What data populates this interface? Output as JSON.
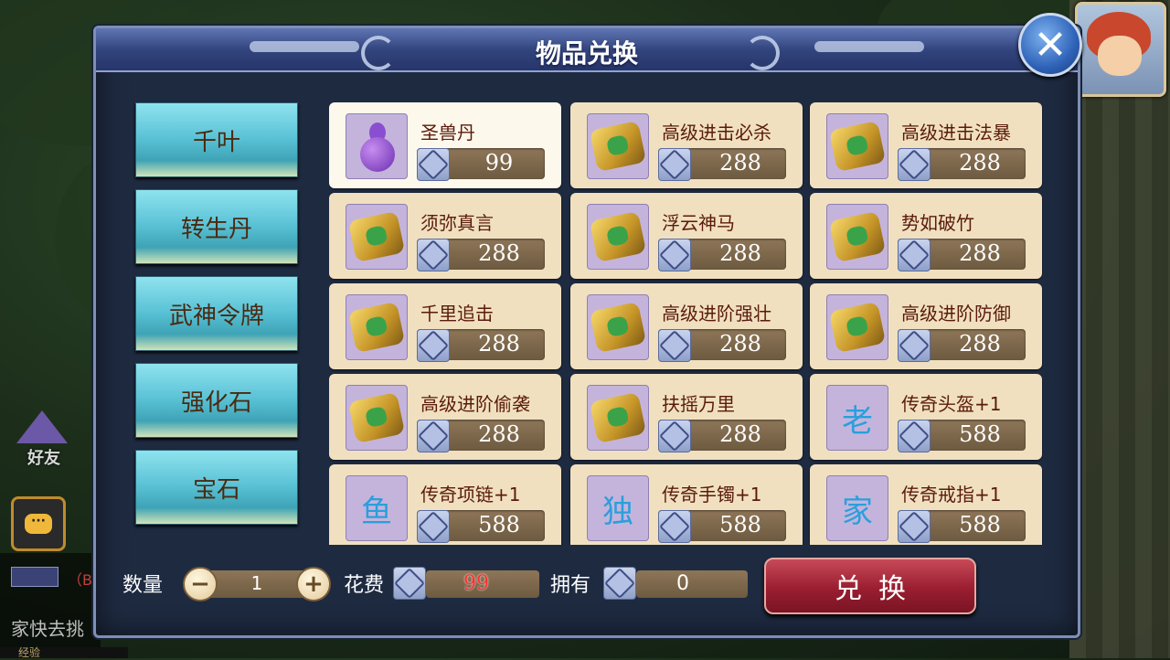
{
  "dialog": {
    "title": "物品兑换"
  },
  "categories": [
    "千叶",
    "转生丹",
    "武神令牌",
    "强化石",
    "宝石"
  ],
  "items": [
    {
      "name": "圣兽丹",
      "price": "99",
      "icon": "gourd-icon",
      "selected": true
    },
    {
      "name": "高级进击必杀",
      "price": "288",
      "icon": "scroll-icon"
    },
    {
      "name": "高级进击法暴",
      "price": "288",
      "icon": "scroll-icon"
    },
    {
      "name": "须弥真言",
      "price": "288",
      "icon": "scroll-icon"
    },
    {
      "name": "浮云神马",
      "price": "288",
      "icon": "scroll-icon"
    },
    {
      "name": "势如破竹",
      "price": "288",
      "icon": "scroll-icon"
    },
    {
      "name": "千里追击",
      "price": "288",
      "icon": "scroll-icon"
    },
    {
      "name": "高级进阶强壮",
      "price": "288",
      "icon": "scroll-icon"
    },
    {
      "name": "高级进阶防御",
      "price": "288",
      "icon": "scroll-icon"
    },
    {
      "name": "高级进阶偷袭",
      "price": "288",
      "icon": "scroll-icon"
    },
    {
      "name": "扶摇万里",
      "price": "288",
      "icon": "scroll-icon"
    },
    {
      "name": "传奇头盔+1",
      "price": "588",
      "icon": "glyph-icon",
      "glyph": "老"
    },
    {
      "name": "传奇项链+1",
      "price": "588",
      "icon": "glyph-icon",
      "glyph": "鱼"
    },
    {
      "name": "传奇手镯+1",
      "price": "588",
      "icon": "glyph-icon",
      "glyph": "独"
    },
    {
      "name": "传奇戒指+1",
      "price": "588",
      "icon": "glyph-icon",
      "glyph": "家"
    }
  ],
  "footer": {
    "qty_label": "数量",
    "qty_value": "1",
    "minus": "−",
    "plus": "+",
    "cost_label": "花费",
    "cost_value": "99",
    "own_label": "拥有",
    "own_value": "0",
    "exchange_label": "兑换"
  },
  "hud": {
    "friends_label": "好友",
    "chat_icon": "···",
    "chat_line": "家快去挑",
    "chat_b": "（B",
    "exp_label": "经验"
  },
  "colors": {
    "price_text": "#ffffff",
    "cost_text": "#ff3030",
    "item_name": "#5a1a0c",
    "category_text": "#4a2a12"
  }
}
